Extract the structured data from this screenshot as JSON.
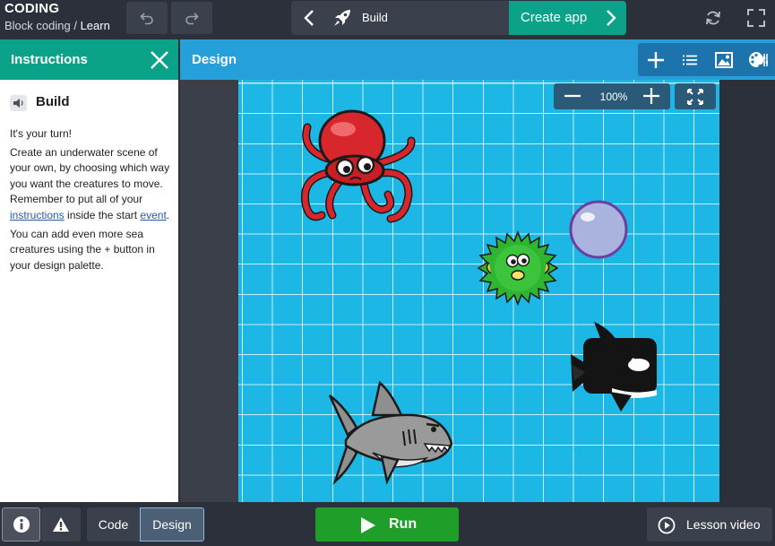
{
  "header": {
    "app_title": "CODING",
    "breadcrumb_parent": "Block coding",
    "breadcrumb_sep": " / ",
    "breadcrumb_current": "Learn",
    "step_label": "Build",
    "create_label": "Create app"
  },
  "instructions": {
    "panel_title": "Instructions",
    "heading": "Build",
    "p1": "It's your turn!",
    "p2_a": "Create an underwater scene of your own, by choosing which way you want the creatures to move. Remember to put all of your ",
    "p2_link1": "instructions",
    "p2_b": " inside the start ",
    "p2_link2": "event",
    "p2_c": ".",
    "p3": "You can add even more sea creatures using the + button in your design palette."
  },
  "design": {
    "title": "Design",
    "zoom": "100%"
  },
  "footer": {
    "code_label": "Code",
    "design_label": "Design",
    "run_label": "Run",
    "lesson_label": "Lesson video"
  },
  "colors": {
    "accent_green": "#0aa38a",
    "design_blue": "#26a0da",
    "stage": "#1cb7e4",
    "run_green": "#1f9e2a",
    "bar_dark": "#2b303a"
  },
  "icons": [
    "undo-icon",
    "redo-icon",
    "chevron-left-icon",
    "rocket-icon",
    "chevron-right-icon",
    "refresh-icon",
    "fullscreen-icon",
    "close-icon",
    "speaker-icon",
    "plus-icon",
    "list-icon",
    "image-icon",
    "palette-icon",
    "minus-icon",
    "fit-icon",
    "info-icon",
    "warning-icon",
    "play-icon",
    "video-icon"
  ]
}
